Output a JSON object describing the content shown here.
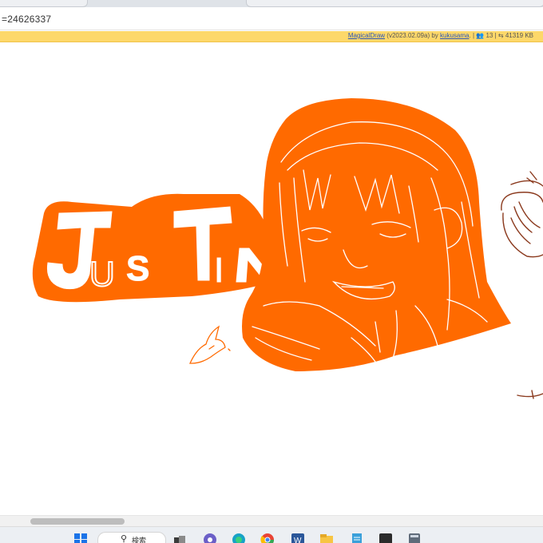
{
  "browser": {
    "address_text": "=24626337"
  },
  "info_bar": {
    "app_link": "MagicalDraw",
    "version": "(v2023.02.09a) by",
    "author_link": "kukusama",
    "separator": ". |",
    "users_icon": "people-icon",
    "users_count": "13",
    "separator2": "|",
    "transfer_icon": "transfer-arrows-icon",
    "size": "41319 KB"
  },
  "canvas": {
    "drawing_text": "JUSTIN",
    "colors": {
      "orange": "#ff6a00",
      "white_line": "#ffffff",
      "sketch_brown": "#8b3a1e"
    }
  },
  "taskbar": {
    "search_label": "検索",
    "icons": [
      "windows-start-icon",
      "search-icon",
      "task-view-icon",
      "teams-chat-icon",
      "edge-icon",
      "chrome-icon",
      "word-icon",
      "file-explorer-icon",
      "notepad-icon",
      "terminal-icon",
      "calculator-icon"
    ]
  }
}
